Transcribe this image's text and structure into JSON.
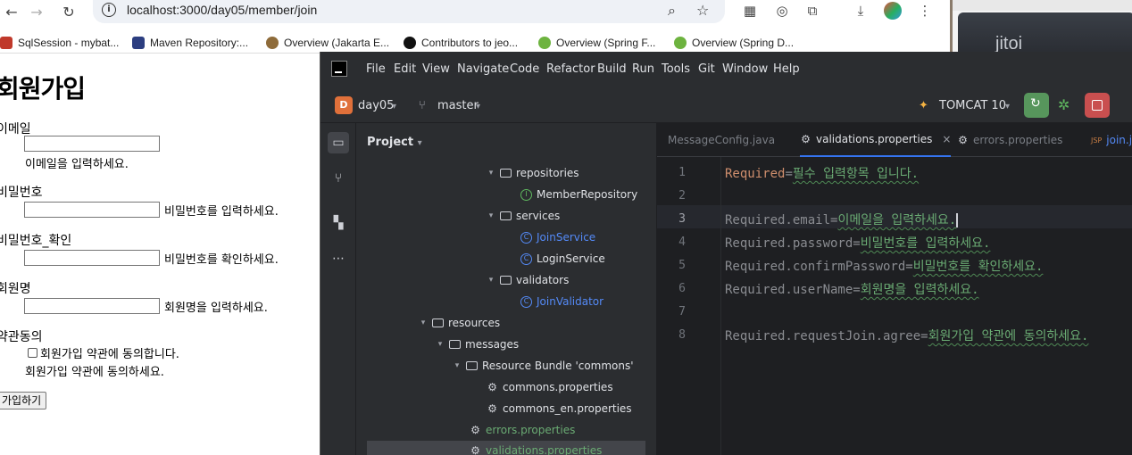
{
  "browser": {
    "url": "localhost:3000/day05/member/join",
    "bookmarks": [
      {
        "label": "SqlSession - mybat...",
        "color": "#c0392b"
      },
      {
        "label": "Maven Repository:...",
        "color": "#2c3e80"
      },
      {
        "label": "Overview (Jakarta E...",
        "color": "#8e6b3a"
      },
      {
        "label": "Contributors to jeo...",
        "color": "#111111"
      },
      {
        "label": "Overview (Spring F...",
        "color": "#6db33f"
      },
      {
        "label": "Overview (Spring D...",
        "color": "#6db33f"
      }
    ],
    "second_window_text": "jitoi"
  },
  "page": {
    "title": "회원가입",
    "fields": [
      {
        "label": "이메일",
        "message": "이메일을 입력하세요."
      },
      {
        "label": "비밀번호",
        "message": "비밀번호를 입력하세요."
      },
      {
        "label": "비밀번호_확인",
        "message": "비밀번호를 확인하세요."
      },
      {
        "label": "회원명",
        "message": "회원명을 입력하세요."
      }
    ],
    "agree_label": "약관동의",
    "agree_checkbox_text": "회원가입 약관에 동의합니다.",
    "agree_message": "회원가입 약관에 동의하세요.",
    "submit_label": "가입하기"
  },
  "ide": {
    "menu": [
      "File",
      "Edit",
      "View",
      "Navigate",
      "Code",
      "Refactor",
      "Build",
      "Run",
      "Tools",
      "Git",
      "Window",
      "Help"
    ],
    "project_initial": "D",
    "project_name": "day05",
    "branch": "master",
    "run_config": "TOMCAT 10",
    "project_panel_title": "Project",
    "tree": [
      {
        "label": "repositories",
        "type": "folder"
      },
      {
        "label": "MemberRepository",
        "type": "interface"
      },
      {
        "label": "services",
        "type": "folder"
      },
      {
        "label": "JoinService",
        "type": "class"
      },
      {
        "label": "LoginService",
        "type": "class"
      },
      {
        "label": "validators",
        "type": "folder"
      },
      {
        "label": "JoinValidator",
        "type": "class"
      },
      {
        "label": "resources",
        "type": "folder"
      },
      {
        "label": "messages",
        "type": "folder"
      },
      {
        "label": "Resource Bundle 'commons'",
        "type": "folder"
      },
      {
        "label": "commons.properties",
        "type": "properties"
      },
      {
        "label": "commons_en.properties",
        "type": "properties"
      },
      {
        "label": "errors.properties",
        "type": "properties"
      },
      {
        "label": "validations.properties",
        "type": "properties"
      }
    ],
    "tabs": [
      {
        "label": "MessageConfig.java",
        "active": false
      },
      {
        "label": "validations.properties",
        "active": true
      },
      {
        "label": "errors.properties",
        "active": false
      },
      {
        "label": "join.j",
        "active": false
      }
    ],
    "tab_jsp_badge": "JSP",
    "line_numbers": [
      "1",
      "2",
      "3",
      "4",
      "5",
      "6",
      "7",
      "8"
    ],
    "current_line": 3,
    "code": [
      {
        "key": "Required",
        "value": "필수 입력항목 입니다."
      },
      {
        "key": "",
        "value": ""
      },
      {
        "key": "Required.email",
        "value": "이메일을 입력하세요."
      },
      {
        "key": "Required.password",
        "value": "비밀번호를 입력하세요."
      },
      {
        "key": "Required.confirmPassword",
        "value": "비밀번호를 확인하세요."
      },
      {
        "key": "Required.userName",
        "value": "회원명을 입력하세요."
      },
      {
        "key": "",
        "value": ""
      },
      {
        "key": "Required.requestJoin.agree",
        "value": "회원가입 약관에 동의하세요."
      }
    ]
  }
}
